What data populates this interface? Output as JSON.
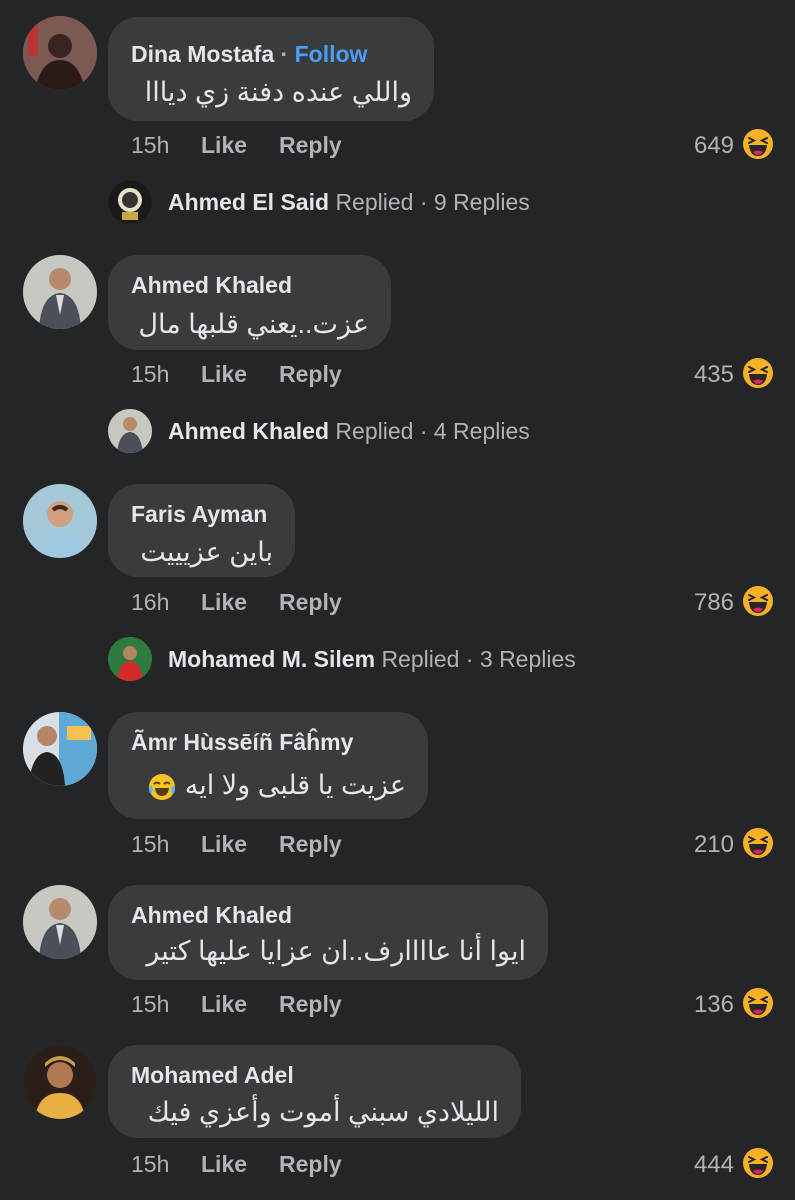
{
  "comments": [
    {
      "name": "Dina Mostafa",
      "follow": "Follow",
      "text": "واللي عنده دفنة زي ديااا",
      "time": "15h",
      "like": "Like",
      "reply": "Reply",
      "count": "649",
      "replies": {
        "name": "Ahmed El Said",
        "replied": "Replied",
        "dot": "·",
        "count": "9 Replies"
      }
    },
    {
      "name": "Ahmed Khaled",
      "text": "عزت..يعني قلبها مال",
      "time": "15h",
      "like": "Like",
      "reply": "Reply",
      "count": "435",
      "replies": {
        "name": "Ahmed Khaled",
        "replied": "Replied",
        "dot": "·",
        "count": "4 Replies"
      }
    },
    {
      "name": "Faris Ayman",
      "text": "باين عزيييت",
      "time": "16h",
      "like": "Like",
      "reply": "Reply",
      "count": "786",
      "replies": {
        "name": "Mohamed M. Silem",
        "replied": "Replied",
        "dot": "·",
        "count": "3 Replies"
      }
    },
    {
      "name": "Ãmr Hùssēíñ Fâĥmy",
      "text": "عزيت يا قلبى ولا ايه",
      "time": "15h",
      "like": "Like",
      "reply": "Reply",
      "count": "210"
    },
    {
      "name": "Ahmed Khaled",
      "text": "ايوا أنا عاااارف..ان عزايا عليها كتير",
      "time": "15h",
      "like": "Like",
      "reply": "Reply",
      "count": "136"
    },
    {
      "name": "Mohamed Adel",
      "text": "الليلادي سبني أموت وأعزي فيك",
      "time": "15h",
      "like": "Like",
      "reply": "Reply",
      "count": "444"
    }
  ],
  "colors": {
    "background": "#242526",
    "bubble": "#3a3b3c",
    "follow": "#4a9ff5",
    "meta": "#b0b3b8",
    "text": "#e4e6eb"
  },
  "icons": {
    "reaction": "haha-emoji-icon",
    "inline_emoji": "tears-of-joy-emoji-icon"
  }
}
